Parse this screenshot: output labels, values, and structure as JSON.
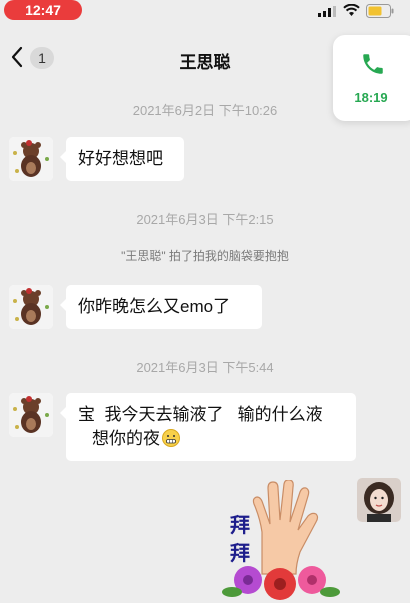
{
  "status_bar": {
    "time": "12:47"
  },
  "header": {
    "title": "王思聪",
    "unread_count": "1"
  },
  "call_widget": {
    "duration": "18:19",
    "accent_color": "#27a852"
  },
  "messages": [
    {
      "timestamp": "2021年6月2日 下午10:26",
      "text": "好好想想吧"
    },
    {
      "timestamp": "2021年6月3日 下午2:15",
      "system_note": "\"王思聪\" 拍了拍我的脑袋要抱抱",
      "text": "你昨晚怎么又emo了"
    },
    {
      "timestamp": "2021年6月3日 下午5:44",
      "line1": "宝  我今天去输液了   输的什么液",
      "line2": "想你的夜"
    }
  ],
  "sticker": {
    "text_line1": "拜",
    "text_line2": "拜"
  }
}
